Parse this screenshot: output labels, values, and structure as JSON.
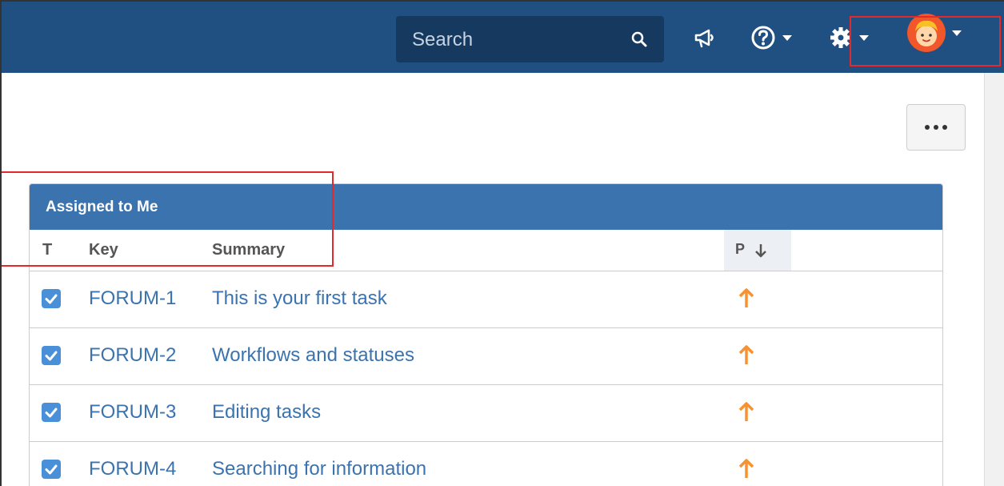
{
  "header": {
    "search_placeholder": "Search",
    "icons": [
      "search-icon",
      "announcement-icon",
      "help-icon",
      "gear-icon",
      "avatar"
    ]
  },
  "gadget": {
    "title": "Assigned to Me",
    "columns": {
      "type": "T",
      "key": "Key",
      "summary": "Summary",
      "priority": "P"
    },
    "rows": [
      {
        "key": "FORUM-1",
        "summary": "This is your first task"
      },
      {
        "key": "FORUM-2",
        "summary": "Workflows and statuses"
      },
      {
        "key": "FORUM-3",
        "summary": "Editing tasks"
      },
      {
        "key": "FORUM-4",
        "summary": "Searching for information"
      }
    ]
  },
  "colors": {
    "header_bg": "#205081",
    "gadget_header_bg": "#3b73af",
    "link": "#3b73af",
    "priority_arrow": "#f79232",
    "highlight": "#e32a2a"
  }
}
